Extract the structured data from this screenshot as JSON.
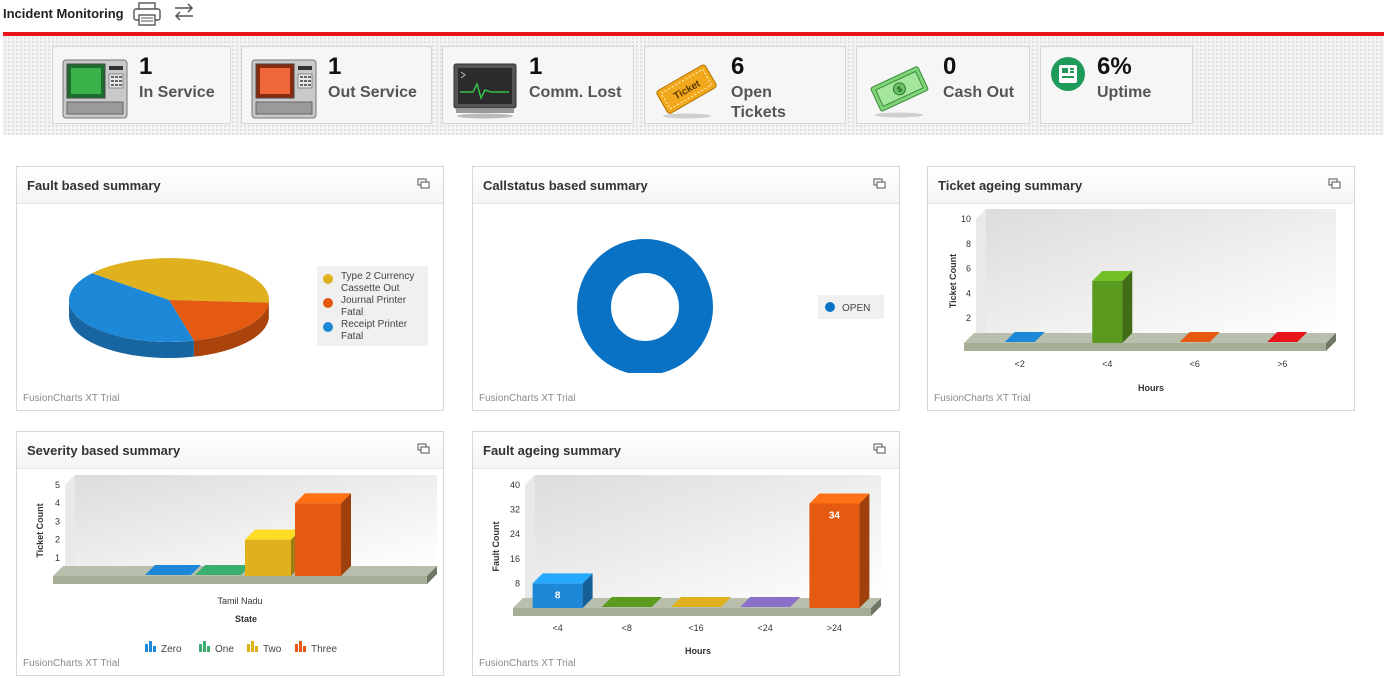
{
  "app": {
    "title": "Incident Monitoring"
  },
  "icons": {
    "print": "printer-icon",
    "swap": "swap-arrows-icon",
    "panel": "maximize-window-icon"
  },
  "colors": {
    "accent": "#e8141b",
    "blue": "#1e88d8",
    "green": "#5a9a1e",
    "orange": "#e35a10",
    "yellow": "#e0b11e"
  },
  "kpis": [
    {
      "value": "1",
      "label": "In Service",
      "icon": "atm-green-icon"
    },
    {
      "value": "1",
      "label": "Out Service",
      "icon": "atm-red-icon"
    },
    {
      "value": "1",
      "label": "Comm. Lost",
      "icon": "monitor-icon"
    },
    {
      "value": "6",
      "label": "Open\nTickets",
      "icon": "ticket-icon"
    },
    {
      "value": "0",
      "label": "Cash Out",
      "icon": "cash-icon"
    },
    {
      "value": "6%",
      "label": "Uptime",
      "icon": "uptime-icon"
    }
  ],
  "watermark": "FusionCharts XT Trial",
  "panels": {
    "fault": {
      "title": "Fault based summary"
    },
    "callstatus": {
      "title": "Callstatus based summary"
    },
    "ticket_ageing": {
      "title": "Ticket ageing summary"
    },
    "severity": {
      "title": "Severity based summary"
    },
    "fault_ageing": {
      "title": "Fault ageing summary"
    }
  },
  "chart_data": [
    {
      "id": "fault",
      "type": "pie",
      "slices": [
        {
          "label": "Type 2 Currency\nCassette Out",
          "value": 2,
          "color": "#e0b11e"
        },
        {
          "label": "Journal Printer\nFatal",
          "value": 1,
          "color": "#e35a10"
        },
        {
          "label": "Receipt Printer\nFatal",
          "value": 2,
          "color": "#1e88d8"
        }
      ],
      "legend_position": "right"
    },
    {
      "id": "callstatus",
      "type": "pie",
      "slices": [
        {
          "label": "OPEN",
          "value": 6,
          "color": "#0a72c4"
        }
      ],
      "legend_position": "right"
    },
    {
      "id": "ticket_ageing",
      "type": "bar",
      "categories": [
        "<2",
        "<4",
        "<6",
        ">6"
      ],
      "values": [
        0,
        5,
        0,
        0
      ],
      "colors": [
        "#1e88d8",
        "#5a9a1e",
        "#e35a10",
        "#e8141b"
      ],
      "xlabel": "Hours",
      "ylabel": "Ticket Count",
      "ylim": [
        0,
        10
      ],
      "ticks": [
        0,
        2,
        4,
        6,
        8,
        10
      ]
    },
    {
      "id": "severity",
      "type": "bar",
      "categories": [
        "Tamil Nadu"
      ],
      "series": [
        {
          "name": "Zero",
          "values": [
            0
          ],
          "color": "#1e88d8"
        },
        {
          "name": "One",
          "values": [
            0
          ],
          "color": "#3aaf70"
        },
        {
          "name": "Two",
          "values": [
            2
          ],
          "color": "#e0b11e"
        },
        {
          "name": "Three",
          "values": [
            4
          ],
          "color": "#e35a10"
        }
      ],
      "xlabel": "State",
      "ylabel": "Ticket Count",
      "ylim": [
        0,
        5
      ],
      "ticks": [
        0,
        1,
        2,
        3,
        4,
        5
      ],
      "legend_position": "bottom"
    },
    {
      "id": "fault_ageing",
      "type": "bar",
      "categories": [
        "<4",
        "<8",
        "<16",
        "<24",
        ">24"
      ],
      "values": [
        8,
        0,
        0,
        0,
        34
      ],
      "labels": [
        "8",
        "",
        "",
        "",
        "34"
      ],
      "colors": [
        "#1e88d8",
        "#5a9a1e",
        "#e0b11e",
        "#8a70c8",
        "#e35a10"
      ],
      "xlabel": "Hours",
      "ylabel": "Fault Count",
      "ylim": [
        0,
        40
      ],
      "ticks": [
        0,
        8,
        16,
        24,
        32,
        40
      ]
    }
  ]
}
